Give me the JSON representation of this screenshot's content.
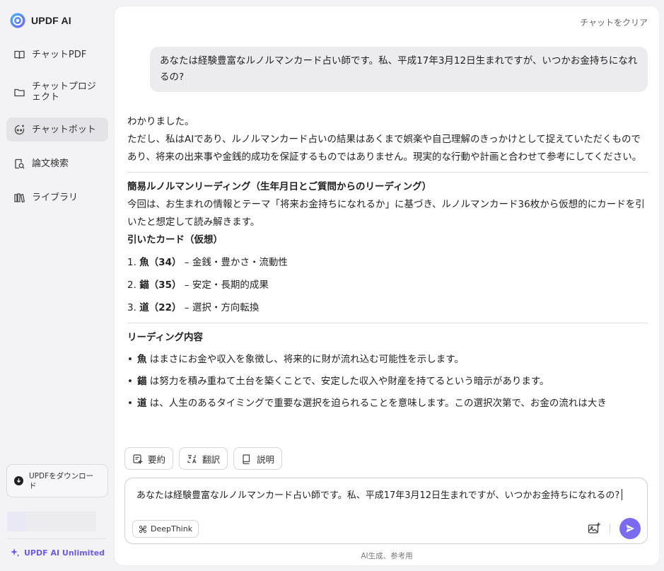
{
  "brand": {
    "name": "UPDF AI"
  },
  "sidebar": {
    "items": [
      {
        "label": "チャットPDF",
        "icon": "book-open-icon"
      },
      {
        "label": "チャットプロジェクト",
        "icon": "folder-icon"
      },
      {
        "label": "チャットボット",
        "icon": "bot-icon",
        "active": true
      },
      {
        "label": "論文検索",
        "icon": "search-doc-icon"
      },
      {
        "label": "ライブラリ",
        "icon": "library-icon"
      }
    ],
    "download_label": "UPDFをダウンロード",
    "unlimited_label": "UPDF AI Unlimited"
  },
  "header": {
    "clear_label": "チャットをクリア"
  },
  "chat": {
    "user_message": "あなたは経験豊富なルノルマンカード占い師です。私、平成17年3月12日生まれですが、いつかお金持ちになれるの?",
    "response": {
      "intro1": "わかりました。",
      "intro2": "ただし、私はAIであり、ルノルマンカード占いの結果はあくまで娯楽や自己理解のきっかけとして捉えていただくものであり、将来の出来事や金銭的成功を保証するものではありません。現実的な行動や計画と合わせて参考にしてください。",
      "heading1": "簡易ルノルマンリーディング（生年月日とご質問からのリーディング）",
      "para1": "今回は、お生まれの情報とテーマ「将来お金持ちになれるか」に基づき、ルノルマンカード36枚から仮想的にカードを引いたと想定して読み解きます。",
      "heading2": "引いたカード（仮想）",
      "cards": [
        {
          "num": "1.",
          "name": "魚（34）",
          "meaning": " – 金銭・豊かさ・流動性"
        },
        {
          "num": "2.",
          "name": "錨（35）",
          "meaning": " – 安定・長期的成果"
        },
        {
          "num": "3.",
          "name": "道（22）",
          "meaning": " – 選択・方向転換"
        }
      ],
      "heading3": "リーディング内容",
      "bullets": [
        {
          "name": "魚",
          "text": " はまさにお金や収入を象徴し、将来的に財が流れ込む可能性を示します。"
        },
        {
          "name": "錨",
          "text": " は努力を積み重ねて土台を築くことで、安定した収入や財産を持てるという暗示があります。"
        },
        {
          "name": "道",
          "text": " は、人生のあるタイミングで重要な選択を迫られることを意味します。この選択次第で、お金の流れは大き"
        }
      ]
    }
  },
  "actions": {
    "summary": "要約",
    "translate": "翻訳",
    "explain": "説明"
  },
  "composer": {
    "value": "あなたは経験豊富なルノルマンカード占い師です。私、平成17年3月12日生まれですが、いつかお金持ちになれるの?",
    "deepthink_label": "DeepThink"
  },
  "footer": {
    "note": "AI生成、参考用"
  },
  "colors": {
    "accent": "#7a6cf0",
    "unlimited": "#6c5ce7",
    "active_bg": "#e4e4e8"
  }
}
